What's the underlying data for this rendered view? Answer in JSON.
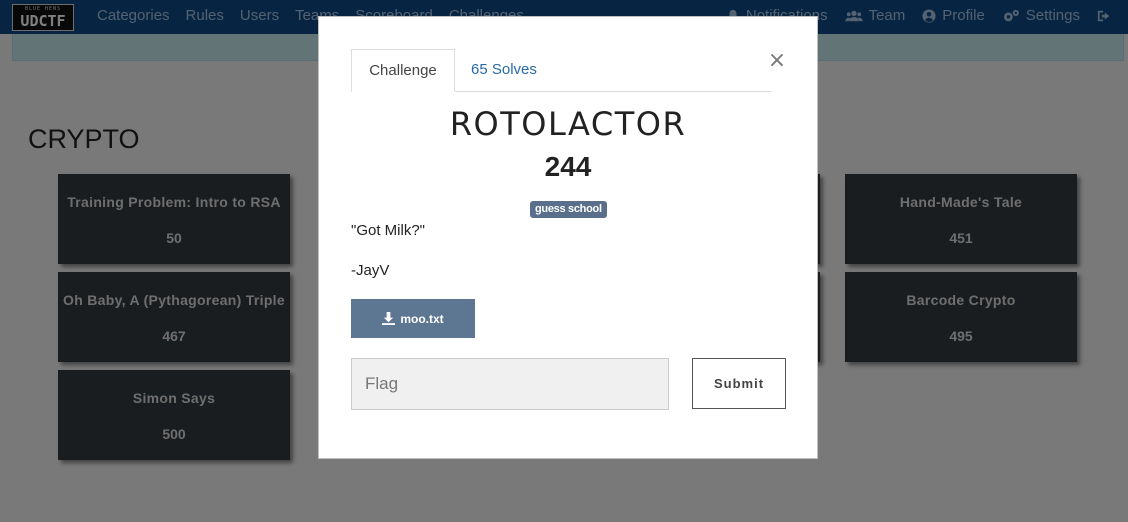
{
  "navbar": {
    "logo_small": "BLUE HENS",
    "logo_main": "UDCTF",
    "links": [
      "Categories",
      "Rules",
      "Users",
      "Teams",
      "Scoreboard",
      "Challenges"
    ],
    "right": {
      "notifications": "Notifications",
      "team": "Team",
      "profile": "Profile",
      "settings": "Settings"
    }
  },
  "main": {
    "section_title": "CRYPTO",
    "cards": [
      {
        "name": "Training Problem: Intro to RSA",
        "value": "50"
      },
      {
        "name": "Oh Baby, A (Pythagorean) Triple",
        "value": "467"
      },
      {
        "name": "Simon Says",
        "value": "500"
      },
      {
        "name": "Hand-Made's Tale",
        "value": "451"
      },
      {
        "name": "Barcode Crypto",
        "value": "495"
      }
    ]
  },
  "modal": {
    "tabs": [
      "Challenge",
      "65 Solves"
    ],
    "close_symbol": "×",
    "challenge_name": "ROTOLACTOR",
    "challenge_value": "244",
    "tag": "guess school",
    "description": [
      "\"Got Milk?\"",
      "-JayV"
    ],
    "file_label": "moo.txt",
    "flag_placeholder": "Flag",
    "submit_label": "Submit"
  },
  "colors": {
    "navbar": "#0f4b86",
    "card": "#343a40",
    "tag": "#5a6f8c",
    "file_button": "#5d7692",
    "tab_link": "#2a6aa6"
  }
}
